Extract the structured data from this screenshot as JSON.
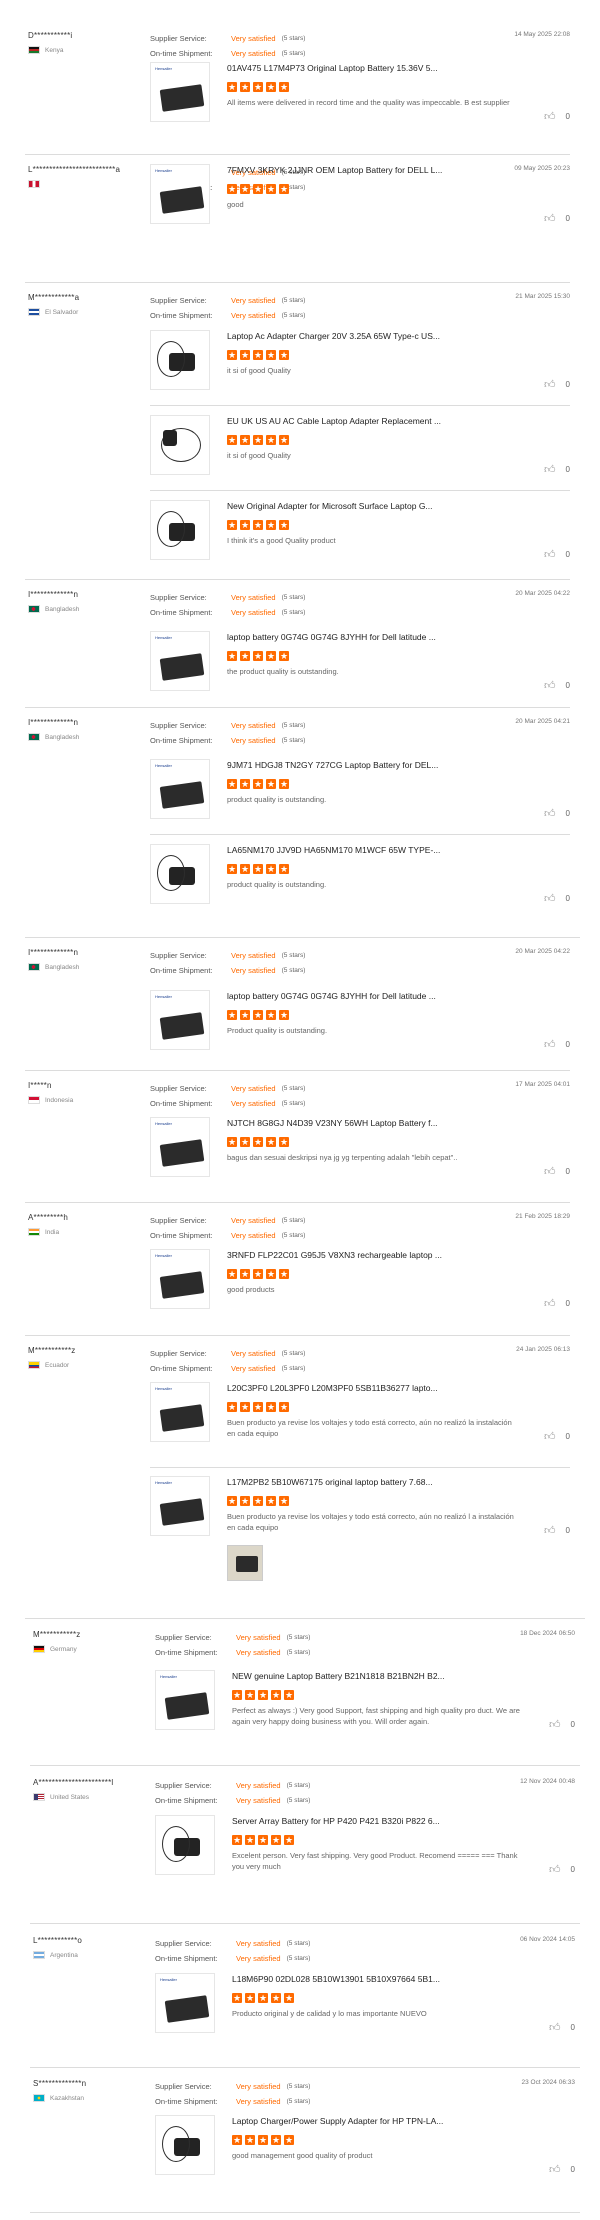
{
  "labels": {
    "supplier_service": "Supplier Service:",
    "on_time_shipment": "On-time Shipment:",
    "rating_value": "Very satisfied",
    "rating_stars": "(5 stars)"
  },
  "reviews": [
    {
      "name": "D***********i",
      "country": "Kenya",
      "date": "14 May 2025 22:08",
      "products": [
        {
          "title": "01AV475 L17M4P73 Original Laptop Battery 15.36V 5...",
          "comment": "All items were delivered in record time and the quality was impeccable. B est supplier",
          "likes": "0",
          "thumb": "battery"
        }
      ]
    },
    {
      "name": "L*************************a",
      "country": "",
      "date": "09 May 2025 20:23",
      "products": [
        {
          "title": "7FMXV 3KRYK 2JJNR OEM Laptop Battery for DELL L...",
          "comment": "good",
          "likes": "0",
          "thumb": "battery"
        }
      ]
    },
    {
      "name": "M************a",
      "country": "El Salvador",
      "date": "21 Mar 2025 15:30",
      "products": [
        {
          "title": "Laptop Ac Adapter Charger 20V 3.25A 65W Type-c US...",
          "comment": "it si of good Quality",
          "likes": "0",
          "thumb": "adapter"
        },
        {
          "title": "EU UK US AU AC Cable Laptop Adapter Replacement ...",
          "comment": "it si of good Quality",
          "likes": "0",
          "thumb": "cable"
        },
        {
          "title": "New Original Adapter for Microsoft Surface Laptop G...",
          "comment": "I think it's a good Quality product",
          "likes": "0",
          "thumb": "adapter"
        }
      ]
    },
    {
      "name": "I*************n",
      "country": "Bangladesh",
      "date": "20 Mar 2025 04:22",
      "products": [
        {
          "title": "laptop battery 0G74G 0G74G 8JYHH for Dell latitude ...",
          "comment": "the product quality is outstanding.",
          "likes": "0",
          "thumb": "battery"
        }
      ]
    },
    {
      "name": "I*************n",
      "country": "Bangladesh",
      "date": "20 Mar 2025 04:21",
      "products": [
        {
          "title": "9JM71 HDGJ8 TN2GY 727CG Laptop Battery for DEL...",
          "comment": "product quality is outstanding.",
          "likes": "0",
          "thumb": "battery"
        },
        {
          "title": "LA65NM170 JJV9D HA65NM170 M1WCF 65W TYPE-...",
          "comment": "product quality is outstanding.",
          "likes": "0",
          "thumb": "adapter"
        }
      ]
    },
    {
      "name": "I*************n",
      "country": "Bangladesh",
      "date": "20 Mar 2025 04:22",
      "products": [
        {
          "title": "laptop battery 0G74G 0G74G 8JYHH for Dell latitude ...",
          "comment": "Product quality is outstanding.",
          "likes": "0",
          "thumb": "battery"
        }
      ]
    },
    {
      "name": "I*****n",
      "country": "Indonesia",
      "date": "17 Mar 2025 04:01",
      "products": [
        {
          "title": "NJTCH 8G8GJ N4D39 V23NY 56WH Laptop Battery f...",
          "comment": "bagus dan sesuai deskripsi nya jg yg terpenting adalah \"lebih cepat\"..",
          "likes": "0",
          "thumb": "battery"
        }
      ]
    },
    {
      "name": "A*********h",
      "country": "India",
      "date": "21 Feb 2025 18:29",
      "products": [
        {
          "title": "3RNFD FLP22C01 G95J5 V8XN3 rechargeable laptop ...",
          "comment": "good products",
          "likes": "0",
          "thumb": "battery"
        }
      ]
    },
    {
      "name": "M***********z",
      "country": "Ecuador",
      "date": "24 Jan 2025 06:13",
      "products": [
        {
          "title": "L20C3PF0 L20L3PF0 L20M3PF0 5SB11B36277 lapto...",
          "comment": "Buen producto ya revise los voltajes y todo está correcto, aún no realizó la instalación en cada equipo",
          "likes": "0",
          "thumb": "battery"
        },
        {
          "title": "L17M2PB2 5B10W67175 original laptop battery 7.68...",
          "comment": "Buen producto ya revise los voltajes y todo está correcto, aún no realizó l a instalación en cada equipo",
          "likes": "0",
          "thumb": "battery"
        }
      ]
    },
    {
      "name": "M***********z",
      "country": "Germany",
      "date": "18 Dec 2024 06:50",
      "products": [
        {
          "title": "NEW genuine Laptop Battery B21N1818 B21BN2H B2...",
          "comment": "Perfect as always :) Very good Support, fast shipping and high quality pro duct. We are again very happy doing business with you. Will order again.",
          "likes": "0",
          "thumb": "battery"
        }
      ]
    },
    {
      "name": "A**********************l",
      "country": "United States",
      "date": "12 Nov 2024 00:48",
      "products": [
        {
          "title": "Server Array Battery for HP P420 P421 B320i P822 6...",
          "comment": "Excelent person. Very fast shipping. Very good Product. Recomend ===== === Thank you very much",
          "likes": "0",
          "thumb": "adapter"
        }
      ]
    },
    {
      "name": "L************o",
      "country": "Argentina",
      "date": "06 Nov 2024 14:05",
      "products": [
        {
          "title": "L18M6P90 02DL028 5B10W13901 5B10X97664 5B1...",
          "comment": "Producto original y de calidad y lo mas importante NUEVO",
          "likes": "0",
          "thumb": "battery"
        }
      ]
    },
    {
      "name": "S*************n",
      "country": "Kazakhstan",
      "date": "23 Oct 2024 06:33",
      "products": [
        {
          "title": "Laptop Charger/Power Supply Adapter for HP TPN-LA...",
          "comment": "good management good quality of product",
          "likes": "0",
          "thumb": "adapter"
        }
      ]
    }
  ],
  "thumb_label": "Hensaller",
  "colors": {
    "accent": "#ff6a00",
    "divider": "#dcdcdc"
  }
}
